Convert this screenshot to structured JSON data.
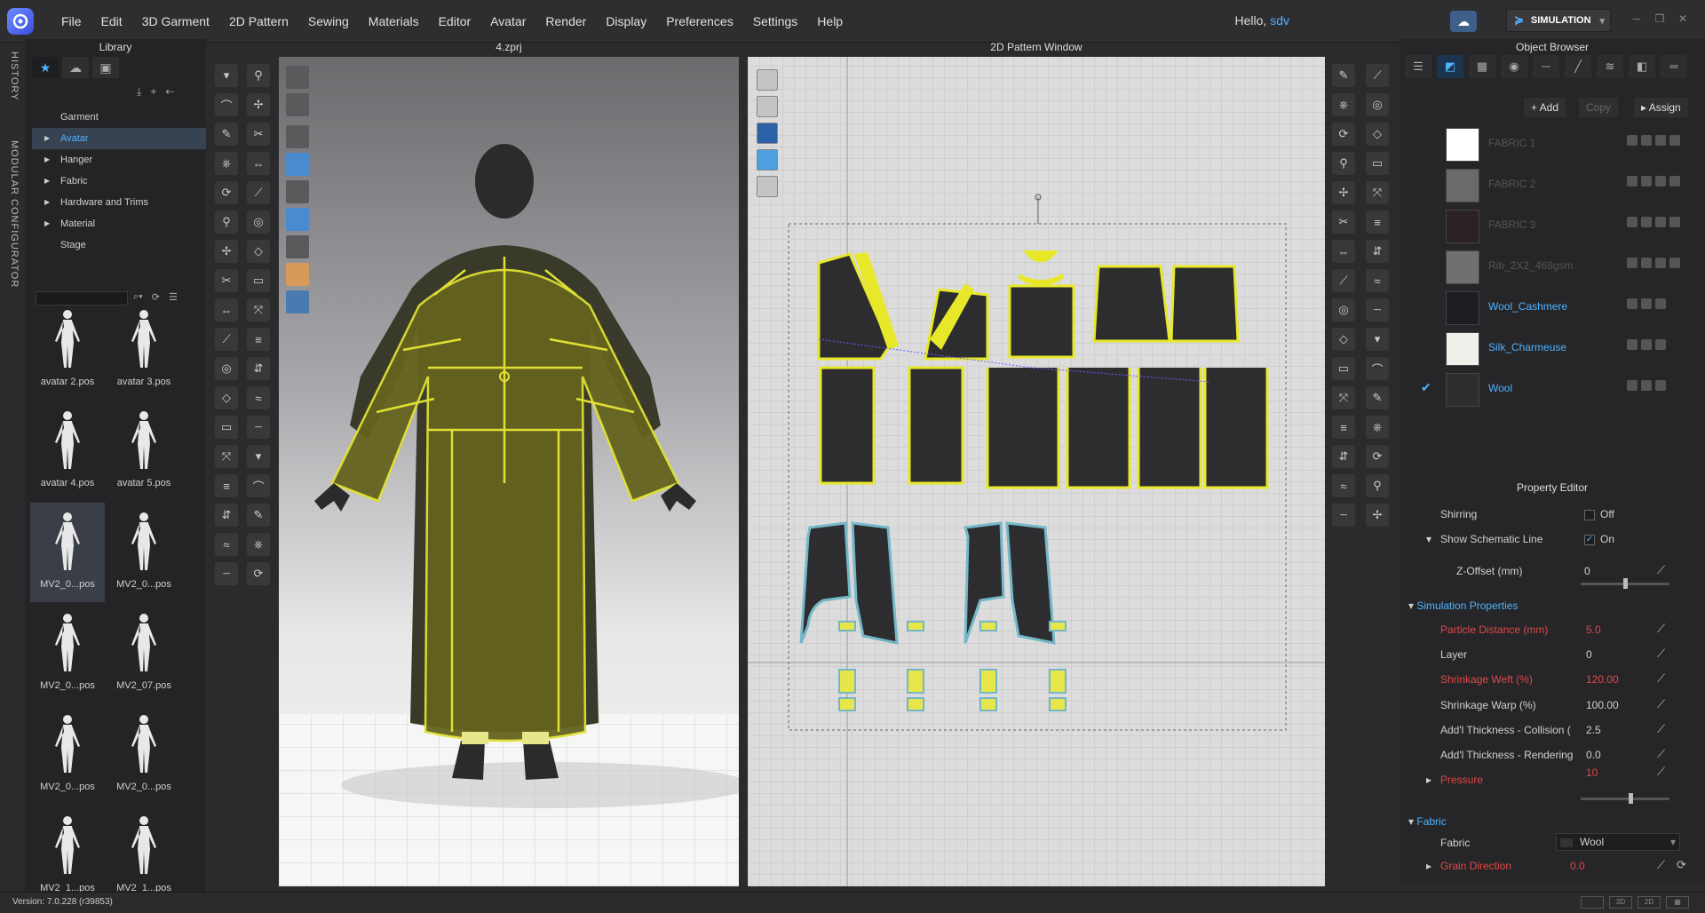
{
  "menubar": {
    "items": [
      "File",
      "Edit",
      "3D Garment",
      "2D Pattern",
      "Sewing",
      "Materials",
      "Editor",
      "Avatar",
      "Render",
      "Display",
      "Preferences",
      "Settings",
      "Help"
    ],
    "hello_prefix": "Hello,",
    "username": "sdv",
    "sim_mode": "SIMULATION"
  },
  "side_tabs": {
    "history": "HISTORY",
    "modular": "MODULAR CONFIGURATOR"
  },
  "library": {
    "title": "Library",
    "tree": [
      "Garment",
      "Avatar",
      "Hanger",
      "Fabric",
      "Hardware and Trims",
      "Material",
      "Stage"
    ],
    "selected": "Avatar",
    "thumbnails": [
      "avatar 2.pos",
      "avatar 3.pos",
      "avatar 4.pos",
      "avatar 5.pos",
      "MV2_0...pos",
      "MV2_0...pos",
      "MV2_0...pos",
      "MV2_07.pos",
      "MV2_0...pos",
      "MV2_0...pos",
      "MV2_1...pos",
      "MV2_1...pos"
    ]
  },
  "view3d": {
    "title": "4.zprj"
  },
  "view2d": {
    "title": "2D Pattern Window"
  },
  "object_browser": {
    "title": "Object Browser",
    "add_label": "+ Add",
    "copy_label": "Copy",
    "assign_label": "Assign",
    "fabrics": [
      {
        "name": "FABRIC 1",
        "color": "#ffffff",
        "dim": true
      },
      {
        "name": "FABRIC 2",
        "color": "#6a6a6a",
        "dim": true
      },
      {
        "name": "FABRIC 3",
        "color": "#2a2222",
        "dim": true
      },
      {
        "name": "Rib_2X2_468gsm",
        "color": "#707070",
        "dim": true
      },
      {
        "name": "Wool_Cashmere",
        "color": "#1c1e24",
        "dim": false
      },
      {
        "name": "Silk_Charmeuse",
        "color": "#eef0ea",
        "dim": false
      },
      {
        "name": "Wool",
        "color": "#2e2e30",
        "dim": false,
        "checked": true
      }
    ]
  },
  "property_editor": {
    "title": "Property Editor",
    "shirring": {
      "label": "Shirring",
      "value": "Off"
    },
    "schematic": {
      "label": "Show Schematic Line",
      "value": "On"
    },
    "zoffset": {
      "label": "Z-Offset (mm)",
      "value": "0"
    },
    "sim_section": "Simulation Properties",
    "particle": {
      "label": "Particle Distance (mm)",
      "value": "5.0"
    },
    "layer": {
      "label": "Layer",
      "value": "0"
    },
    "weft": {
      "label": "Shrinkage Weft (%)",
      "value": "120.00"
    },
    "warp": {
      "label": "Shrinkage Warp (%)",
      "value": "100.00"
    },
    "collision": {
      "label": "Add'l Thickness - Collision (",
      "value": "2.5"
    },
    "rendering": {
      "label": "Add'l Thickness - Rendering",
      "value": "0.0"
    },
    "pressure": {
      "label": "Pressure",
      "value": "10"
    },
    "fabric_section": "Fabric",
    "fabric": {
      "label": "Fabric",
      "value": "Wool"
    },
    "grain": {
      "label": "Grain Direction",
      "value": "0.0"
    }
  },
  "status": {
    "version": "Version: 7.0.228 (r39853)"
  }
}
